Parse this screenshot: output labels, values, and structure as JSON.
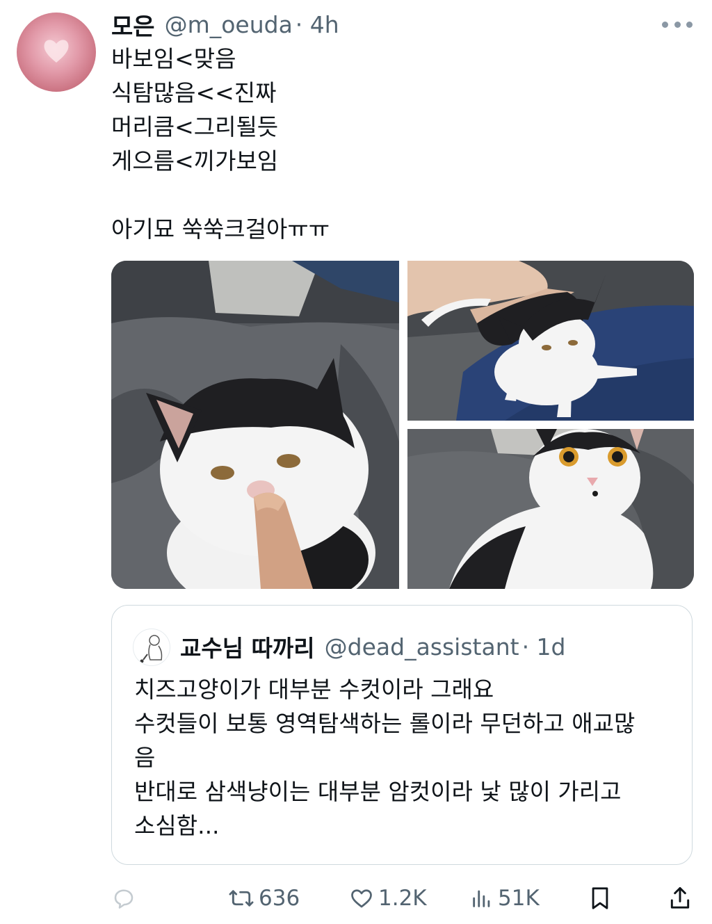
{
  "tweet": {
    "author_name": "모은",
    "author_handle": "@m_oeuda",
    "time": "· 4h",
    "text": "바보임<맞음\n식탐많음<<진짜\n머리큼<그리될듯\n게으름<끼가보임\n\n아기묘 쑥쑥크걸아ㅠㅠ"
  },
  "media": {
    "photos": [
      "cat-photo-finger-boop",
      "cat-photo-on-blue-cushion",
      "cat-photo-sitting-front"
    ]
  },
  "quote": {
    "author_name": "교수님 따까리",
    "author_handle": "@dead_assistant",
    "time": "· 1d",
    "text": "치즈고양이가 대부분 수컷이라 그래요\n수컷들이 보통 영역탐색하는 롤이라 무던하고 애교많\n음\n반대로 삼색냥이는 대부분 암컷이라 낯 많이 가리고\n소심함..."
  },
  "actions": {
    "reply_count": "",
    "retweet_count": "636",
    "like_count": "1.2K",
    "views_count": "51K"
  },
  "icons": [
    "more-icon",
    "reply-icon",
    "retweet-icon",
    "like-icon",
    "views-icon",
    "bookmark-icon",
    "share-icon"
  ],
  "colors": {
    "text": "#0f1419",
    "secondary": "#536471",
    "border": "#cfd9de"
  }
}
